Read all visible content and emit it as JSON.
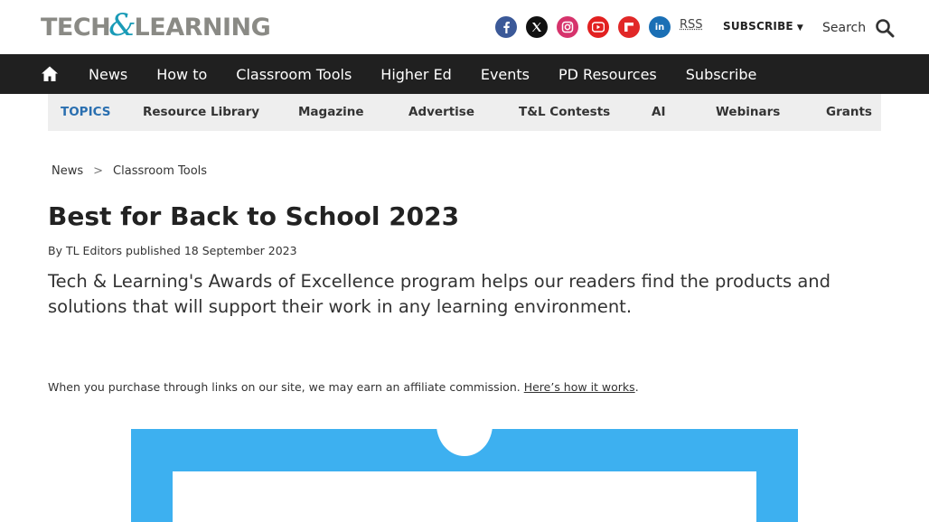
{
  "header": {
    "logo_left": "TECH",
    "logo_amp": "&",
    "logo_right": "LEARNING",
    "socials": [
      {
        "name": "facebook",
        "color": "#3b5998",
        "glyph": "f"
      },
      {
        "name": "x",
        "color": "#111111",
        "glyph": "𝕏"
      },
      {
        "name": "instagram",
        "color": "#d6336c",
        "glyph": "◎"
      },
      {
        "name": "youtube",
        "color": "#e22020",
        "glyph": "▶"
      },
      {
        "name": "flipboard",
        "color": "#e12828",
        "glyph": "f"
      },
      {
        "name": "linkedin",
        "color": "#1a6fb5",
        "glyph": "in"
      }
    ],
    "rss_label": "RSS",
    "subscribe_label": "SUBSCRIBE",
    "search_label": "Search"
  },
  "nav": {
    "items": [
      "News",
      "How to",
      "Classroom Tools",
      "Higher Ed",
      "Events",
      "PD Resources",
      "Subscribe"
    ]
  },
  "topics": {
    "label": "TOPICS",
    "items": [
      "Resource Library",
      "Magazine",
      "Advertise",
      "T&L Contests",
      "AI",
      "Webinars",
      "Grants"
    ]
  },
  "breadcrumb": {
    "items": [
      "News",
      "Classroom Tools"
    ],
    "separator": ">"
  },
  "article": {
    "title": "Best for Back to School 2023",
    "by_prefix": "By",
    "author": "TL Editors",
    "published": "published 18 September 2023",
    "strap": "Tech & Learning's Awards of Excellence program helps our readers find the products and solutions that will support their work in any learning environment.",
    "affiliate_text": "When you purchase through links on our site, we may earn an affiliate commission.",
    "affiliate_link": "Here’s how it works",
    "affiliate_end": "."
  },
  "colors": {
    "nav_bg": "#202020",
    "topics_bg": "#eeeeee",
    "topics_label": "#2a6fb0",
    "hero_blue": "#3db0f0",
    "logo_gray": "#8a8a85",
    "logo_teal": "#1a9bb7"
  }
}
